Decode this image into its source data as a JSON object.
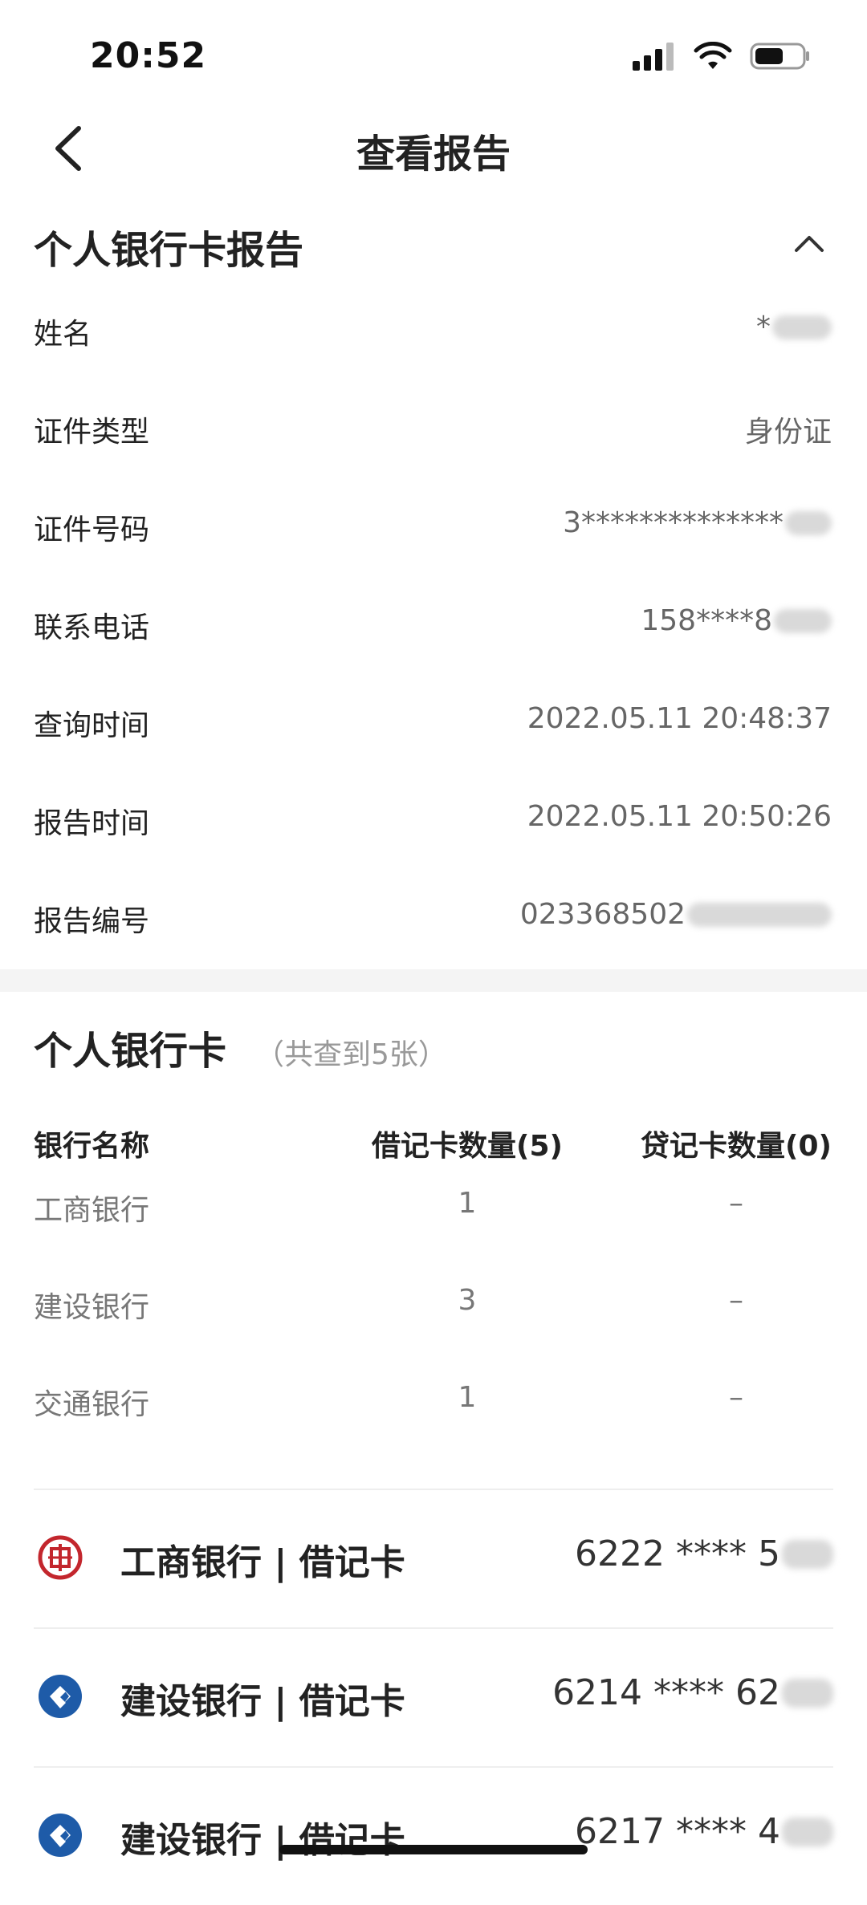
{
  "status_bar": {
    "time": "20:52"
  },
  "nav": {
    "title": "查看报告"
  },
  "report_section": {
    "title": "个人银行卡报告",
    "rows": [
      {
        "label": "姓名",
        "value": "*"
      },
      {
        "label": "证件类型",
        "value": "身份证"
      },
      {
        "label": "证件号码",
        "value": "3**************"
      },
      {
        "label": "联系电话",
        "value": "158****8"
      },
      {
        "label": "查询时间",
        "value": "2022.05.11 20:48:37"
      },
      {
        "label": "报告时间",
        "value": "2022.05.11 20:50:26"
      },
      {
        "label": "报告编号",
        "value": "023368502"
      }
    ]
  },
  "cards_section": {
    "title": "个人银行卡",
    "count": "（共查到5张）",
    "table": {
      "headers": [
        "银行名称",
        "借记卡数量(5)",
        "贷记卡数量(0)"
      ],
      "rows": [
        [
          "工商银行",
          "1",
          "–"
        ],
        [
          "建设银行",
          "3",
          "–"
        ],
        [
          "交通银行",
          "1",
          "–"
        ]
      ]
    },
    "cards": [
      {
        "name": "工商银行 | 借记卡",
        "number": "6222 **** 5",
        "logo": "icbc-logo",
        "color": "#c3262d"
      },
      {
        "name": "建设银行 | 借记卡",
        "number": "6214 **** 62",
        "logo": "ccb-logo",
        "color": "#1e5ba8"
      },
      {
        "name": "建设银行 | 借记卡",
        "number": "6217 **** 4",
        "logo": "ccb-logo",
        "color": "#1e5ba8"
      }
    ]
  }
}
